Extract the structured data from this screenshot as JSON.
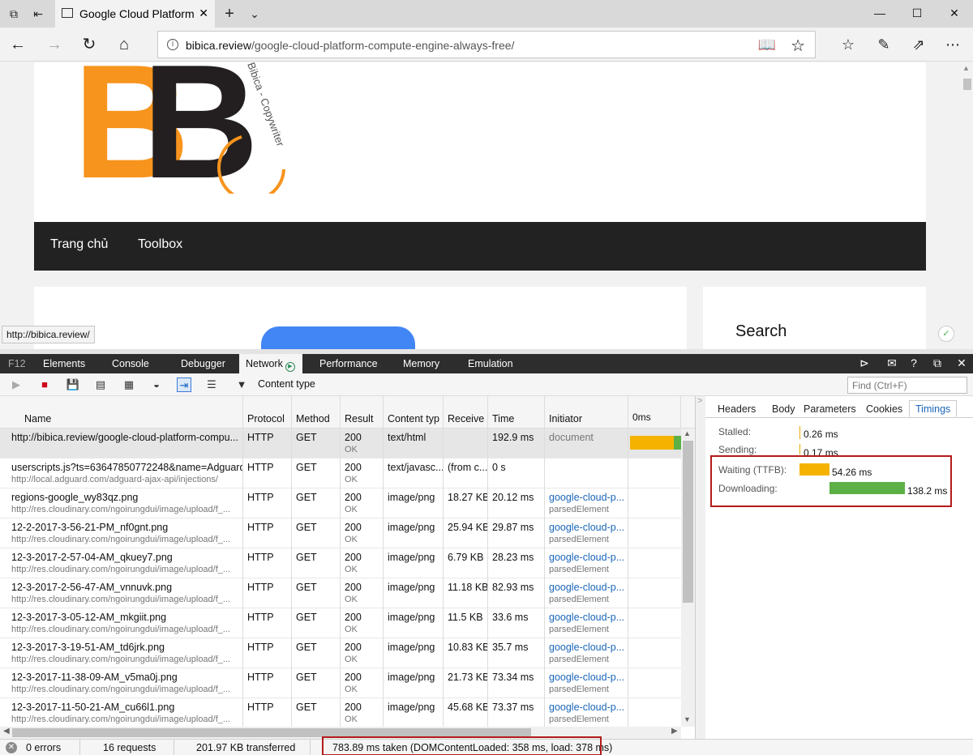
{
  "browser": {
    "tab_title": "Google Cloud Platform",
    "url_host": "bibica.review",
    "url_path": "/google-cloud-platform-compute-engine-always-free/"
  },
  "page": {
    "logo_text": "Bibica - Copywriter",
    "menu": [
      "Trang chủ",
      "Toolbox"
    ],
    "sidebar_search": "Search",
    "status_url": "http://bibica.review/"
  },
  "devtools": {
    "tabs": [
      "F12",
      "Elements",
      "Console",
      "Debugger",
      "Network",
      "Performance",
      "Memory",
      "Emulation"
    ],
    "filter_label": "Content type",
    "find_placeholder": "Find (Ctrl+F)",
    "columns": [
      "Name",
      "Protocol",
      "Method",
      "Result",
      "Content typ",
      "Receive",
      "Time",
      "Initiator",
      "0ms"
    ],
    "rows": [
      {
        "name": "http://bibica.review/google-cloud-platform-compu...",
        "sub": "",
        "protocol": "HTTP",
        "method": "GET",
        "result": "200",
        "result_sub": "OK",
        "ctype": "text/html",
        "receive": "",
        "time": "192.9 ms",
        "initiator": "document",
        "initiator_sub": ""
      },
      {
        "name": "userscripts.js?ts=63647850772248&name=Adguard...",
        "sub": "http://local.adguard.com/adguard-ajax-api/injections/",
        "protocol": "HTTP",
        "method": "GET",
        "result": "200",
        "result_sub": "OK",
        "ctype": "text/javasc...",
        "receive": "(from c...",
        "time": "0 s",
        "initiator": "",
        "initiator_sub": ""
      },
      {
        "name": "regions-google_wy83qz.png",
        "sub": "http://res.cloudinary.com/ngoirungdui/image/upload/f_...",
        "protocol": "HTTP",
        "method": "GET",
        "result": "200",
        "result_sub": "OK",
        "ctype": "image/png",
        "receive": "18.27 KB",
        "time": "20.12 ms",
        "initiator": "google-cloud-p...",
        "initiator_sub": "parsedElement"
      },
      {
        "name": "12-2-2017-3-56-21-PM_nf0gnt.png",
        "sub": "http://res.cloudinary.com/ngoirungdui/image/upload/f_...",
        "protocol": "HTTP",
        "method": "GET",
        "result": "200",
        "result_sub": "OK",
        "ctype": "image/png",
        "receive": "25.94 KB",
        "time": "29.87 ms",
        "initiator": "google-cloud-p...",
        "initiator_sub": "parsedElement"
      },
      {
        "name": "12-3-2017-2-57-04-AM_qkuey7.png",
        "sub": "http://res.cloudinary.com/ngoirungdui/image/upload/f_...",
        "protocol": "HTTP",
        "method": "GET",
        "result": "200",
        "result_sub": "OK",
        "ctype": "image/png",
        "receive": "6.79 KB",
        "time": "28.23 ms",
        "initiator": "google-cloud-p...",
        "initiator_sub": "parsedElement"
      },
      {
        "name": "12-3-2017-2-56-47-AM_vnnuvk.png",
        "sub": "http://res.cloudinary.com/ngoirungdui/image/upload/f_...",
        "protocol": "HTTP",
        "method": "GET",
        "result": "200",
        "result_sub": "OK",
        "ctype": "image/png",
        "receive": "11.18 KB",
        "time": "82.93 ms",
        "initiator": "google-cloud-p...",
        "initiator_sub": "parsedElement"
      },
      {
        "name": "12-3-2017-3-05-12-AM_mkgiit.png",
        "sub": "http://res.cloudinary.com/ngoirungdui/image/upload/f_...",
        "protocol": "HTTP",
        "method": "GET",
        "result": "200",
        "result_sub": "OK",
        "ctype": "image/png",
        "receive": "11.5 KB",
        "time": "33.6 ms",
        "initiator": "google-cloud-p...",
        "initiator_sub": "parsedElement"
      },
      {
        "name": "12-3-2017-3-19-51-AM_td6jrk.png",
        "sub": "http://res.cloudinary.com/ngoirungdui/image/upload/f_...",
        "protocol": "HTTP",
        "method": "GET",
        "result": "200",
        "result_sub": "OK",
        "ctype": "image/png",
        "receive": "10.83 KB",
        "time": "35.7 ms",
        "initiator": "google-cloud-p...",
        "initiator_sub": "parsedElement"
      },
      {
        "name": "12-3-2017-11-38-09-AM_v5ma0j.png",
        "sub": "http://res.cloudinary.com/ngoirungdui/image/upload/f_...",
        "protocol": "HTTP",
        "method": "GET",
        "result": "200",
        "result_sub": "OK",
        "ctype": "image/png",
        "receive": "21.73 KB",
        "time": "73.34 ms",
        "initiator": "google-cloud-p...",
        "initiator_sub": "parsedElement"
      },
      {
        "name": "12-3-2017-11-50-21-AM_cu66l1.png",
        "sub": "http://res.cloudinary.com/ngoirungdui/image/upload/f_...",
        "protocol": "HTTP",
        "method": "GET",
        "result": "200",
        "result_sub": "OK",
        "ctype": "image/png",
        "receive": "45.68 KB",
        "time": "73.37 ms",
        "initiator": "google-cloud-p...",
        "initiator_sub": "parsedElement"
      }
    ],
    "detail_tabs": [
      "Headers",
      "Body",
      "Parameters",
      "Cookies",
      "Timings"
    ],
    "timings": [
      {
        "label": "Stalled:",
        "value": "0.26 ms"
      },
      {
        "label": "Sending:",
        "value": "0.17 ms"
      },
      {
        "label": "Waiting (TTFB):",
        "value": "54.26 ms"
      },
      {
        "label": "Downloading:",
        "value": "138.2 ms"
      }
    ],
    "status": {
      "errors": "0 errors",
      "requests": "16 requests",
      "transferred": "201.97 KB transferred",
      "taken": "783.89 ms taken (DOMContentLoaded: 358 ms, load: 378 ms)"
    }
  },
  "colors": {
    "ttfb": "#f5b300",
    "download": "#5cb046",
    "highlight": "#b41b1b",
    "link": "#1a66b8"
  }
}
